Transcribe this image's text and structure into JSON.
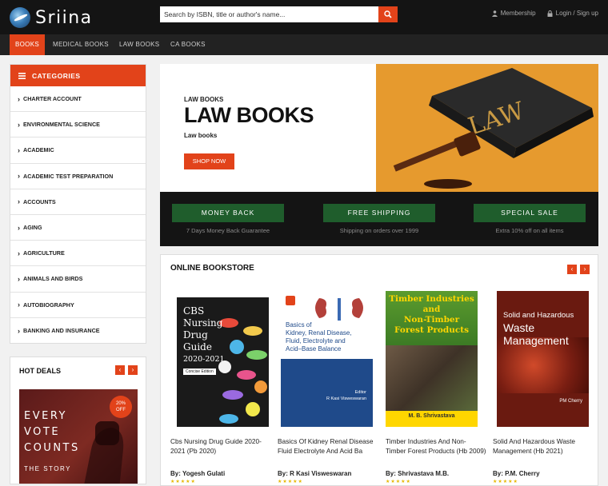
{
  "header": {
    "logo_text": "Sriina",
    "search_placeholder": "Search by ISBN, title or author's name...",
    "membership_label": "Membership",
    "login_label": "Login / Sign up"
  },
  "nav": {
    "items": [
      {
        "label": "BOOKS",
        "active": true
      },
      {
        "label": "MEDICAL BOOKS",
        "active": false
      },
      {
        "label": "LAW BOOKS",
        "active": false
      },
      {
        "label": "CA BOOKS",
        "active": false
      }
    ]
  },
  "sidebar": {
    "categories_label": "CATEGORIES",
    "categories": [
      "CHARTER ACCOUNT",
      "ENVIRONMENTAL SCIENCE",
      "ACADEMIC",
      "ACADEMIC TEST PREPARATION",
      "ACCOUNTS",
      "AGING",
      "AGRICULTURE",
      "ANIMALS AND BIRDS",
      "AUTOBIOGRAPHY",
      "BANKING AND INSURANCE"
    ],
    "hot_deals_label": "HOT DEALS",
    "hot_deal": {
      "line1": "EVERY",
      "line2": "VOTE",
      "line3": "COUNTS",
      "subtitle": "THE STORY",
      "badge_percent": "20%",
      "badge_off": "OFF"
    }
  },
  "banner": {
    "kicker": "LAW BOOKS",
    "title": "LAW BOOKS",
    "subtitle": "Law books",
    "cta_label": "SHOP NOW",
    "image_text": "LAW"
  },
  "features": [
    {
      "label": "MONEY BACK",
      "sub": "7 Days Money Back Guarantee"
    },
    {
      "label": "FREE SHIPPING",
      "sub": "Shipping on orders over 1999"
    },
    {
      "label": "SPECIAL SALE",
      "sub": "Extra 10% off on all items"
    }
  ],
  "store": {
    "title": "ONLINE BOOKSTORE",
    "books": [
      {
        "title": "Cbs Nursing Drug Guide 2020-2021 (Pb 2020)",
        "author": "By: Yogesh Gulati",
        "cover": {
          "l1": "CBS",
          "l2": "Nursing",
          "l3": "Drug",
          "l4": "Guide",
          "l5": "2020-2021",
          "edition": "Concise Edition"
        }
      },
      {
        "title": "Basics Of Kidney Renal Disease Fluid Electrolyte And Acid Ba",
        "author": "By: R Kasi Visweswaran",
        "cover": {
          "l1": "Basics of",
          "l2": "Kidney, Renal Disease,",
          "l3": "Fluid, Electrolyte and",
          "l4": "Acid–Base Balance",
          "editor_label": "Editor",
          "editor": "R Kasi Visweswaran"
        }
      },
      {
        "title": "Timber Industries And Non-Timber Forest Products (Hb 2009)",
        "author": "By: Shrivastava M.B.",
        "cover": {
          "l1": "Timber Industries",
          "l2": "and",
          "l3": "Non-Timber",
          "l4": "Forest Products",
          "author": "M. B. Shrivastava"
        }
      },
      {
        "title": "Solid And Hazardous Waste Management (Hb 2021)",
        "author": "By: P.M. Cherry",
        "cover": {
          "l1": "Solid and Hazardous",
          "l2": "Waste",
          "l3": "Management",
          "author": "PM Cherry"
        }
      }
    ]
  },
  "colors": {
    "accent": "#e2431a",
    "feature_green": "#1f5d2c",
    "banner_orange": "#e69a2e",
    "topbar": "#141414"
  }
}
